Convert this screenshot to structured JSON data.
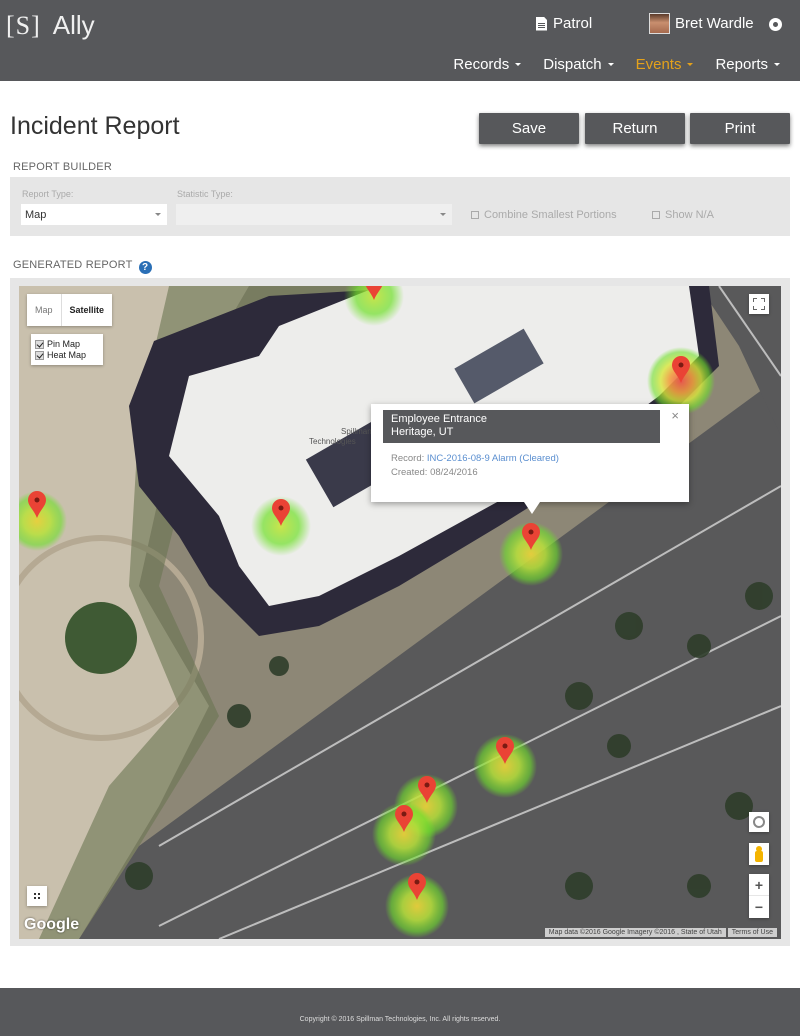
{
  "app": {
    "logo_mark": "[S]",
    "name": "Ally"
  },
  "header": {
    "patrol_label": "Patrol",
    "user_name": "Bret Wardle",
    "nav": [
      {
        "label": "Records",
        "active": false
      },
      {
        "label": "Dispatch",
        "active": false
      },
      {
        "label": "Events",
        "active": true
      },
      {
        "label": "Reports",
        "active": false
      }
    ],
    "accent_color": "#e4a11b"
  },
  "page": {
    "title": "Incident Report",
    "buttons": {
      "save": "Save",
      "return": "Return",
      "print": "Print"
    }
  },
  "report_builder": {
    "section_label": "REPORT BUILDER",
    "report_type_label": "Report Type:",
    "report_type_value": "Map",
    "statistic_type_label": "Statistic Type:",
    "statistic_type_value": "",
    "combine_label": "Combine Smallest Portions",
    "combine_checked": false,
    "show_na_label": "Show N/A",
    "show_na_checked": false
  },
  "generated_report": {
    "section_label": "GENERATED REPORT",
    "help_icon": "?",
    "map": {
      "type_options": [
        "Map",
        "Satellite"
      ],
      "selected_type": "Satellite",
      "layers": [
        {
          "label": "Pin Map",
          "checked": true
        },
        {
          "label": "Heat Map",
          "checked": true
        }
      ],
      "info_window": {
        "title_line1": "Employee Entrance",
        "title_line2": "Heritage, UT",
        "record_label": "Record:",
        "record_link": "INC-2016-08-9 Alarm (Cleared)",
        "created_label": "Created:",
        "created_value": "08/24/2016",
        "close": "×"
      },
      "zoom_in": "+",
      "zoom_out": "−",
      "google_logo": "Google",
      "attribution": "Map data ©2016 Google Imagery ©2016 , State of Utah",
      "terms": "Terms of Use",
      "building_label": "Spillman Technologies",
      "pins": [
        {
          "name": "pin-top",
          "intensity": "low"
        },
        {
          "name": "pin-northeast",
          "intensity": "high"
        },
        {
          "name": "pin-west",
          "intensity": "medium"
        },
        {
          "name": "pin-building",
          "intensity": "medium"
        },
        {
          "name": "pin-employee-entrance",
          "intensity": "medium"
        },
        {
          "name": "pin-parking-1",
          "intensity": "medium"
        },
        {
          "name": "pin-parking-2",
          "intensity": "medium"
        },
        {
          "name": "pin-parking-3",
          "intensity": "medium"
        },
        {
          "name": "pin-parking-4",
          "intensity": "medium"
        }
      ]
    }
  },
  "footer": {
    "copyright": "Copyright © 2016 Spillman Technologies, Inc. All rights reserved."
  }
}
